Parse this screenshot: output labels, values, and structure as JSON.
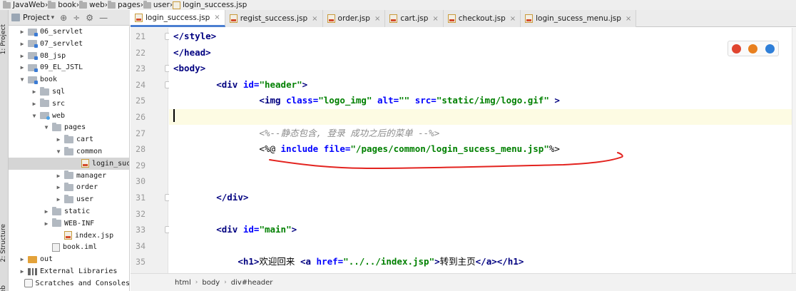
{
  "breadcrumb": [
    "JavaWeb",
    "book",
    "web",
    "pages",
    "user",
    "login_success.jsp"
  ],
  "left_strip": {
    "project_label": "1: Project",
    "structure_label": "2: Structure",
    "web_label": "Web"
  },
  "project_panel": {
    "title": "Project",
    "dropdown": "▾",
    "tools": [
      "⊕",
      "÷",
      "⚙",
      "—"
    ]
  },
  "tree": [
    {
      "label": "06_servlet",
      "icon": "module-folder-icon",
      "arrow": "▶",
      "indent": 0
    },
    {
      "label": "07_servlet",
      "icon": "module-folder-icon",
      "arrow": "▶",
      "indent": 0
    },
    {
      "label": "08_jsp",
      "icon": "module-folder-icon",
      "arrow": "▶",
      "indent": 0
    },
    {
      "label": "09_EL_JSTL",
      "icon": "module-folder-icon",
      "arrow": "▶",
      "indent": 0
    },
    {
      "label": "book",
      "icon": "module-folder-icon",
      "arrow": "▼",
      "indent": 0
    },
    {
      "label": "sql",
      "icon": "folder-icon",
      "arrow": "▶",
      "indent": 1
    },
    {
      "label": "src",
      "icon": "folder-icon",
      "arrow": "▶",
      "indent": 1
    },
    {
      "label": "web",
      "icon": "web-folder-icon",
      "arrow": "▼",
      "indent": 1
    },
    {
      "label": "pages",
      "icon": "folder-icon",
      "arrow": "▼",
      "indent": 2
    },
    {
      "label": "cart",
      "icon": "folder-icon",
      "arrow": "▶",
      "indent": 3
    },
    {
      "label": "common",
      "icon": "folder-icon",
      "arrow": "▼",
      "indent": 3
    },
    {
      "label": "login_sucess_menu.jsp",
      "icon": "jsp-file-icon",
      "arrow": "",
      "indent": 5,
      "selected": true
    },
    {
      "label": "manager",
      "icon": "folder-icon",
      "arrow": "▶",
      "indent": 3
    },
    {
      "label": "order",
      "icon": "folder-icon",
      "arrow": "▶",
      "indent": 3
    },
    {
      "label": "user",
      "icon": "folder-icon",
      "arrow": "▶",
      "indent": 3
    },
    {
      "label": "static",
      "icon": "folder-icon",
      "arrow": "▶",
      "indent": 2
    },
    {
      "label": "WEB-INF",
      "icon": "folder-icon",
      "arrow": "▶",
      "indent": 2
    },
    {
      "label": "index.jsp",
      "icon": "jsp-file-icon",
      "arrow": "",
      "indent": 3
    },
    {
      "label": "book.iml",
      "icon": "iml-file-icon",
      "arrow": "",
      "indent": 2
    },
    {
      "label": "out",
      "icon": "orange-folder-icon",
      "arrow": "▶",
      "indent": 0
    },
    {
      "label": "External Libraries",
      "icon": "libraries-icon",
      "arrow": "▶",
      "indent": 0
    },
    {
      "label": "Scratches and Consoles",
      "icon": "scratches-icon",
      "arrow": "",
      "indent": 0
    }
  ],
  "tabs": [
    {
      "label": "login_success.jsp",
      "active": true
    },
    {
      "label": "regist_success.jsp",
      "active": false
    },
    {
      "label": "order.jsp",
      "active": false
    },
    {
      "label": "cart.jsp",
      "active": false
    },
    {
      "label": "checkout.jsp",
      "active": false
    },
    {
      "label": "login_sucess_menu.jsp",
      "active": false
    }
  ],
  "tab_close": "×",
  "editor": {
    "lines": [
      {
        "n": "21",
        "fold": true,
        "parts": [
          [
            "tag",
            "</style>"
          ]
        ]
      },
      {
        "n": "22",
        "fold": false,
        "parts": [
          [
            "tag",
            "</head>"
          ]
        ]
      },
      {
        "n": "23",
        "fold": true,
        "parts": [
          [
            "tag",
            "<body>"
          ]
        ]
      },
      {
        "n": "24",
        "fold": true,
        "parts": [
          [
            "plain",
            "        "
          ],
          [
            "tag",
            "<div "
          ],
          [
            "attr",
            "id="
          ],
          [
            "str",
            "\"header\""
          ],
          [
            "tag",
            ">"
          ]
        ]
      },
      {
        "n": "25",
        "fold": false,
        "parts": [
          [
            "plain",
            "                "
          ],
          [
            "tag",
            "<img "
          ],
          [
            "attr",
            "class="
          ],
          [
            "str",
            "\"logo_img\" "
          ],
          [
            "attr",
            "alt="
          ],
          [
            "str",
            "\"\" "
          ],
          [
            "attr",
            "src="
          ],
          [
            "str",
            "\"static/img/logo.gif\""
          ],
          [
            "tag",
            " >"
          ]
        ]
      },
      {
        "n": "26",
        "fold": false,
        "current": true,
        "parts": [
          [
            "plain",
            ""
          ]
        ]
      },
      {
        "n": "27",
        "fold": false,
        "parts": [
          [
            "plain",
            "                "
          ],
          [
            "cmt",
            "<%--静态包含, 登录 成功之后的菜单 --%>"
          ]
        ]
      },
      {
        "n": "28",
        "fold": false,
        "parts": [
          [
            "plain",
            "                "
          ],
          [
            "dir",
            "<%@ "
          ],
          [
            "attr",
            "include "
          ],
          [
            "attr",
            "file="
          ],
          [
            "str",
            "\"/pages/common/login_sucess_menu.jsp\""
          ],
          [
            "dir",
            "%>"
          ]
        ]
      },
      {
        "n": "29",
        "fold": false,
        "parts": [
          [
            "plain",
            ""
          ]
        ]
      },
      {
        "n": "30",
        "fold": false,
        "parts": [
          [
            "plain",
            ""
          ]
        ]
      },
      {
        "n": "31",
        "fold": true,
        "parts": [
          [
            "plain",
            "        "
          ],
          [
            "tag",
            "</div>"
          ]
        ]
      },
      {
        "n": "32",
        "fold": false,
        "parts": [
          [
            "plain",
            ""
          ]
        ]
      },
      {
        "n": "33",
        "fold": true,
        "parts": [
          [
            "plain",
            "        "
          ],
          [
            "tag",
            "<div "
          ],
          [
            "attr",
            "id="
          ],
          [
            "str",
            "\"main\""
          ],
          [
            "tag",
            ">"
          ]
        ]
      },
      {
        "n": "34",
        "fold": false,
        "parts": [
          [
            "plain",
            ""
          ]
        ]
      },
      {
        "n": "35",
        "fold": false,
        "parts": [
          [
            "plain",
            "            "
          ],
          [
            "tag",
            "<h1>"
          ],
          [
            "plain",
            "欢迎回来 "
          ],
          [
            "tag",
            "<a "
          ],
          [
            "attr",
            "href="
          ],
          [
            "str",
            "\"../../index.jsp\""
          ],
          [
            "tag",
            ">"
          ],
          [
            "plain",
            "转到主页"
          ],
          [
            "tag",
            "</a></h1>"
          ]
        ]
      }
    ]
  },
  "browsers": [
    {
      "name": "chrome-icon",
      "color": "#e0452f"
    },
    {
      "name": "firefox-icon",
      "color": "#e8801f"
    },
    {
      "name": "ie-icon",
      "color": "#2f7fd8"
    }
  ],
  "statusbar": [
    "html",
    "body",
    "div#header"
  ],
  "statusbar_sep": "›",
  "annotation_color": "#e3231f"
}
